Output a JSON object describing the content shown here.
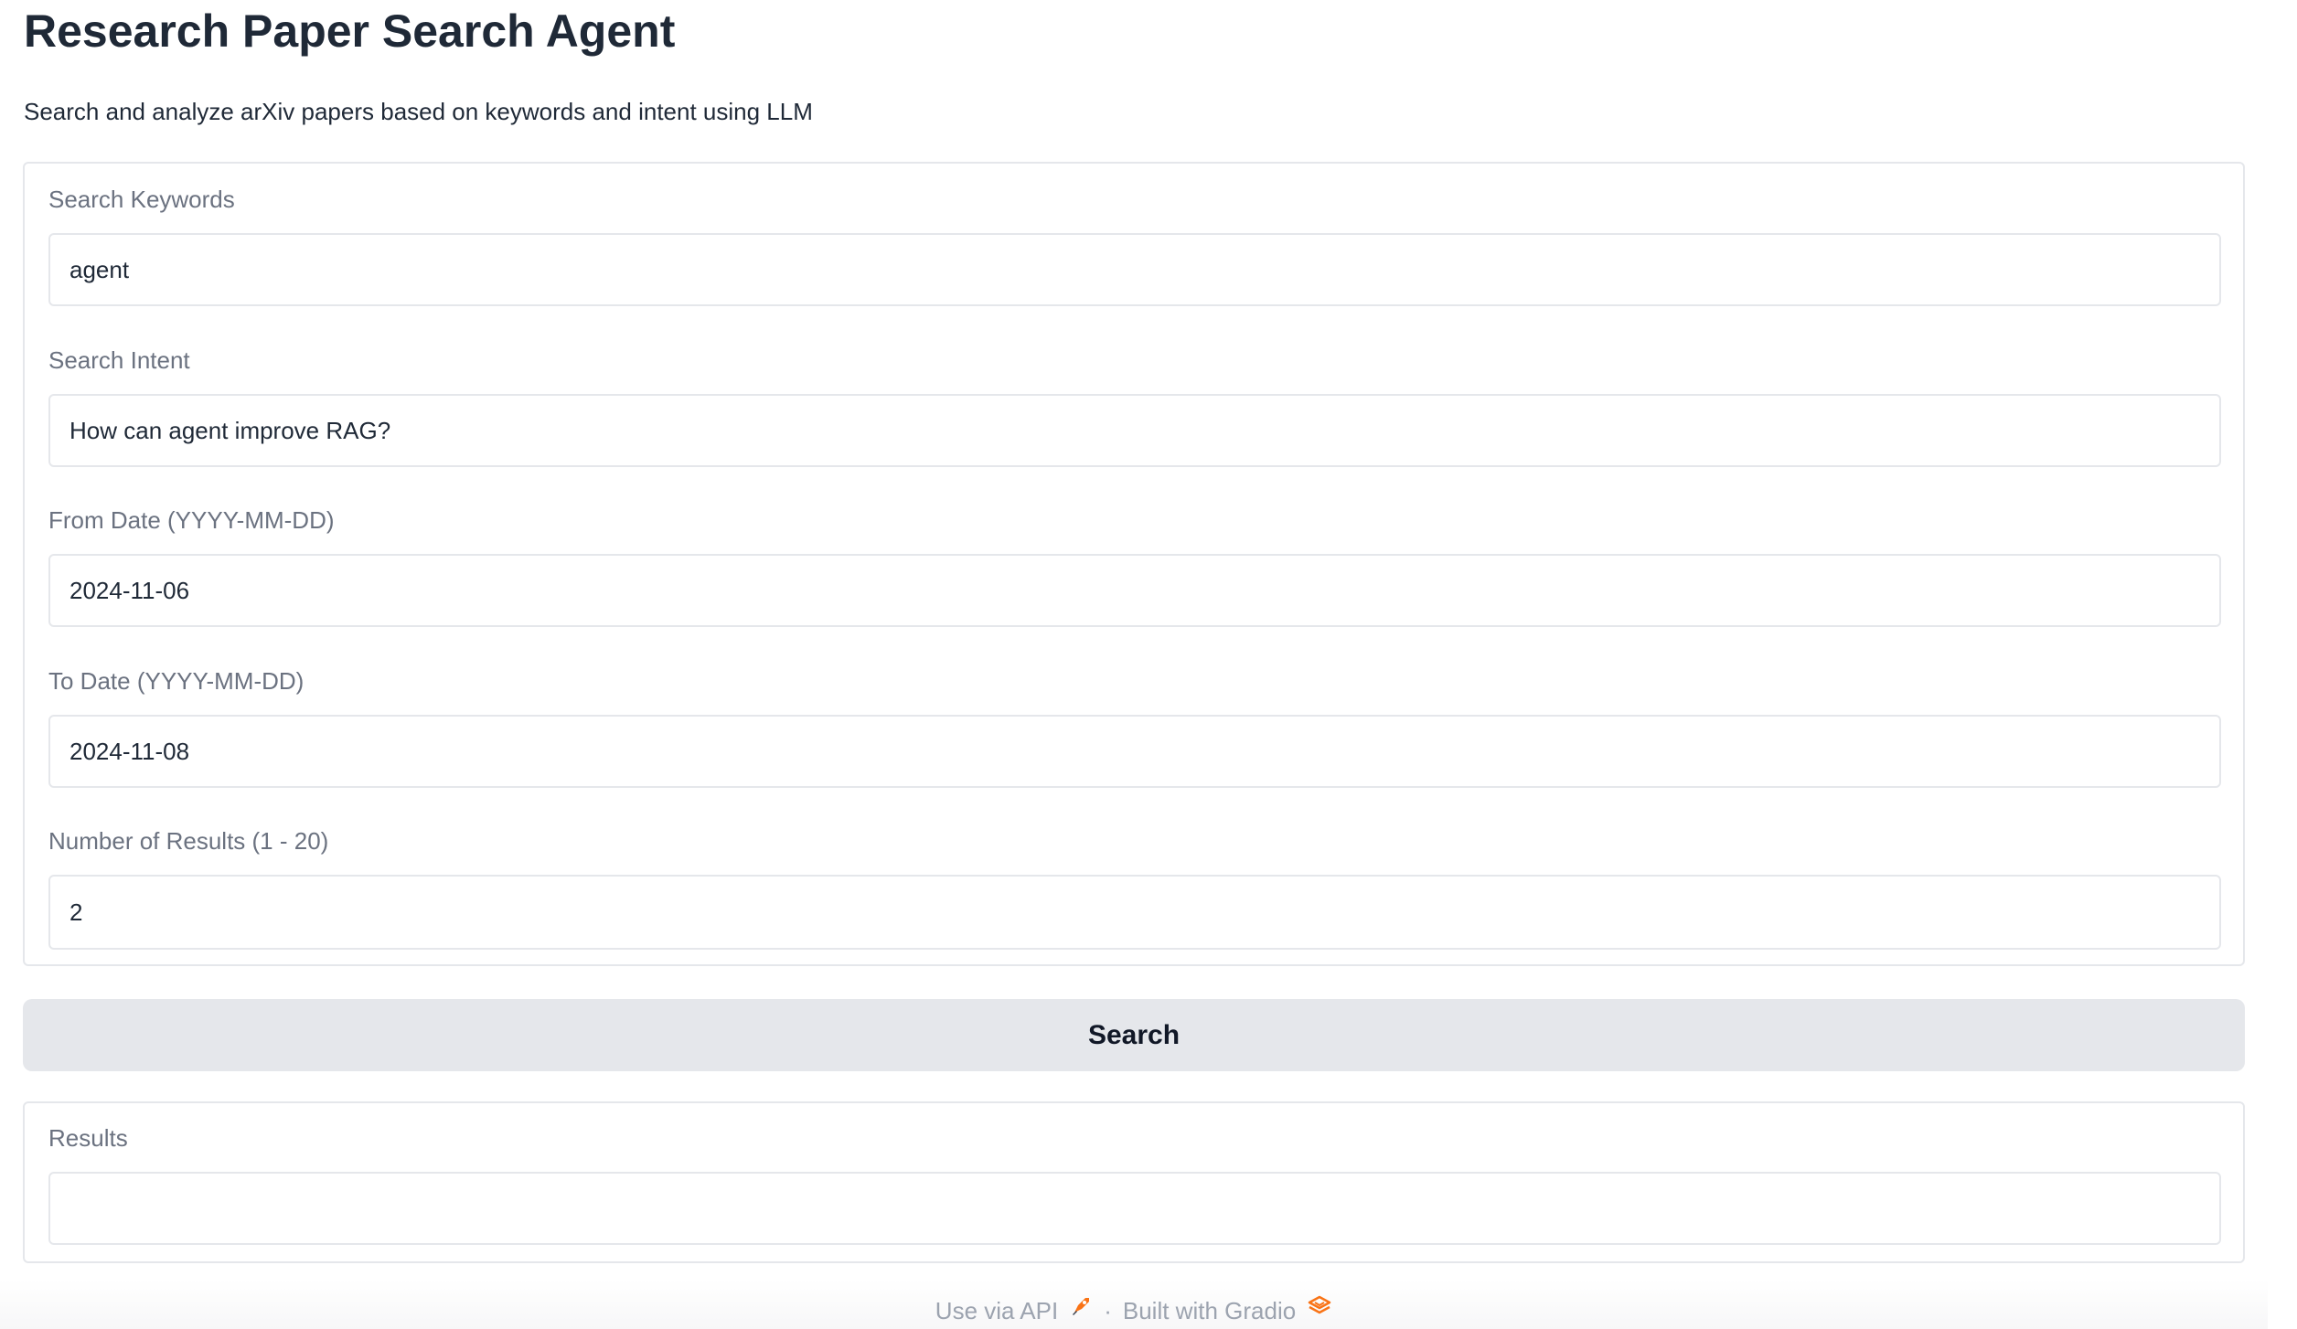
{
  "header": {
    "title": "Research Paper Search Agent",
    "subtitle": "Search and analyze arXiv papers based on keywords and intent using LLM"
  },
  "form": {
    "keywords": {
      "label": "Search Keywords",
      "value": "agent"
    },
    "intent": {
      "label": "Search Intent",
      "value": "How can agent improve RAG?"
    },
    "from_date": {
      "label": "From Date (YYYY-MM-DD)",
      "value": "2024-11-06"
    },
    "to_date": {
      "label": "To Date (YYYY-MM-DD)",
      "value": "2024-11-08"
    },
    "num_results": {
      "label": "Number of Results (1 - 20)",
      "value": "2"
    }
  },
  "actions": {
    "search_label": "Search"
  },
  "results": {
    "label": "Results",
    "value": ""
  },
  "footer": {
    "api_link": "Use via API",
    "separator": "·",
    "built_with": "Built with Gradio",
    "api_icon": "rocket-icon",
    "gradio_icon": "gradio-logo-icon"
  },
  "colors": {
    "button_bg": "#e5e7eb",
    "border": "#e5e7eb",
    "label_text": "#6b7280",
    "footer_text": "#9ca3af",
    "accent_orange": "#f97316"
  }
}
